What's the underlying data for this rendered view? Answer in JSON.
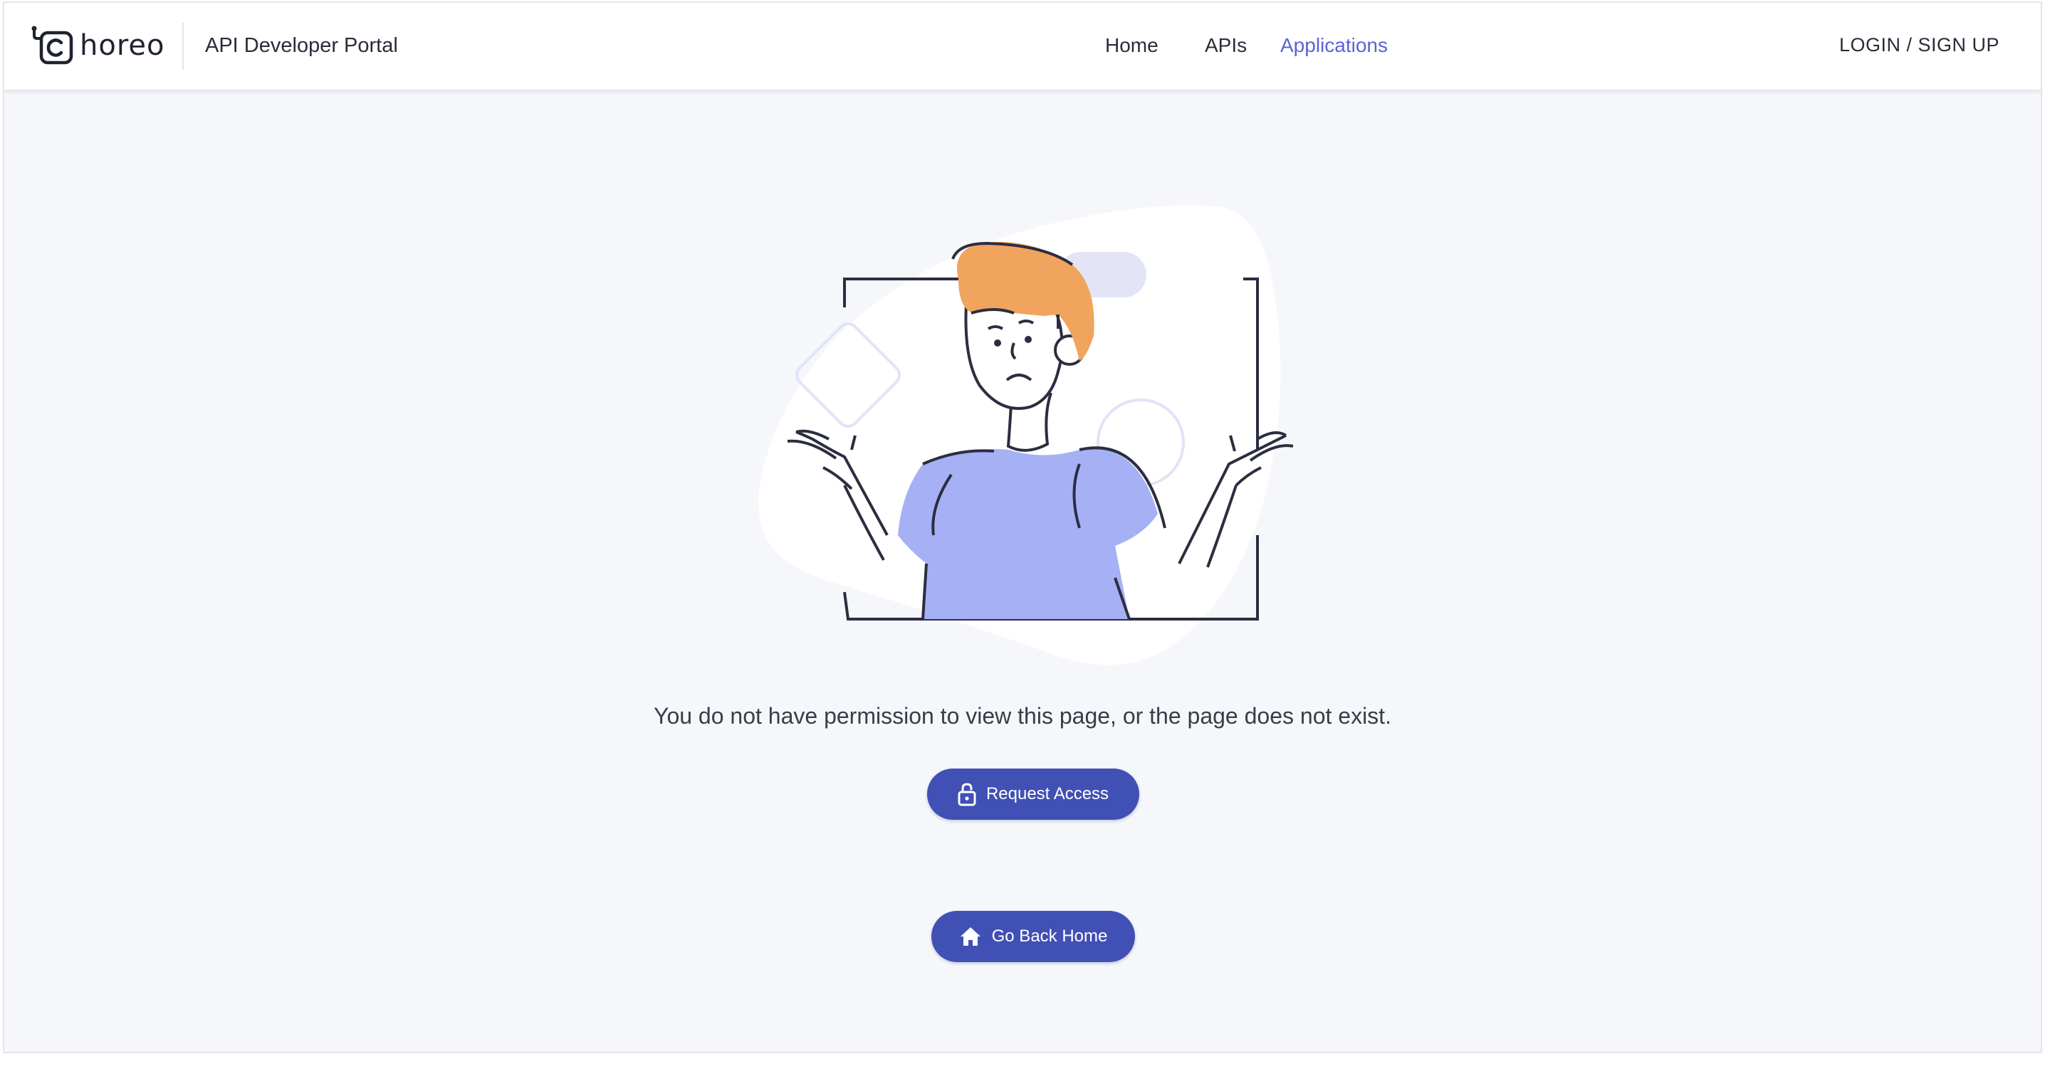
{
  "header": {
    "logo_text": "horeo",
    "portal_title": "API Developer Portal",
    "nav": [
      {
        "label": "Home",
        "active": false
      },
      {
        "label": "APIs",
        "active": false
      },
      {
        "label": "Applications",
        "active": true
      }
    ],
    "login_label": "LOGIN / SIGN UP"
  },
  "main": {
    "message": "You do not have permission to view this page, or the page does not exist.",
    "request_access_label": "Request Access",
    "go_back_home_label": "Go Back Home"
  },
  "icons": {
    "logo": "choreo-logo-icon",
    "request_access": "lock-open-icon",
    "go_back_home": "home-icon"
  },
  "colors": {
    "accent": "#4150b4",
    "nav_active": "#5b63d3",
    "page_background": "#f6f7fb",
    "hair": "#f0a45e",
    "shirt": "#a6b0f4"
  }
}
